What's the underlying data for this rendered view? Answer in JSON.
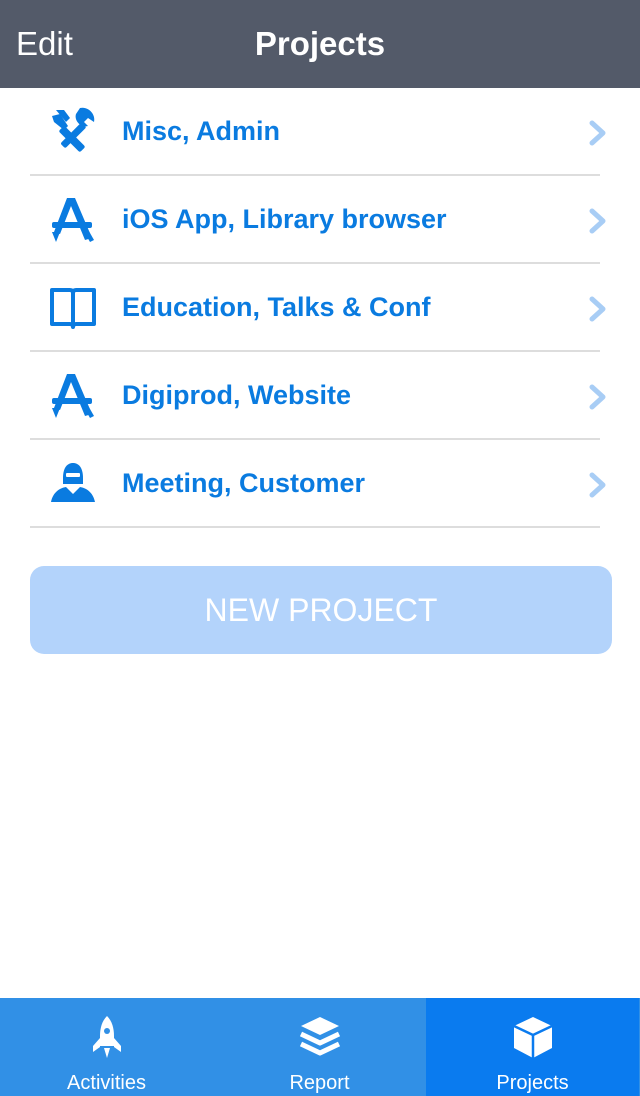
{
  "nav": {
    "edit_label": "Edit",
    "title": "Projects"
  },
  "projects": [
    {
      "label": "Misc, Admin",
      "icon": "tools-icon"
    },
    {
      "label": "iOS App, Library browser",
      "icon": "app-store-icon"
    },
    {
      "label": "Education, Talks & Conf",
      "icon": "book-icon"
    },
    {
      "label": "Digiprod, Website",
      "icon": "app-store-icon"
    },
    {
      "label": "Meeting, Customer",
      "icon": "person-icon"
    }
  ],
  "new_project_label": "NEW PROJECT",
  "tabs": [
    {
      "label": "Activities",
      "icon": "rocket-icon",
      "active": false
    },
    {
      "label": "Report",
      "icon": "layers-icon",
      "active": false
    },
    {
      "label": "Projects",
      "icon": "box-icon",
      "active": true
    }
  ],
  "colors": {
    "navbar": "#535a69",
    "accent": "#0a7be0",
    "button": "#b3d3fb",
    "tabbar": "#3190e6",
    "tab_active": "#0a7bef",
    "chevron": "#a8cdf5"
  }
}
